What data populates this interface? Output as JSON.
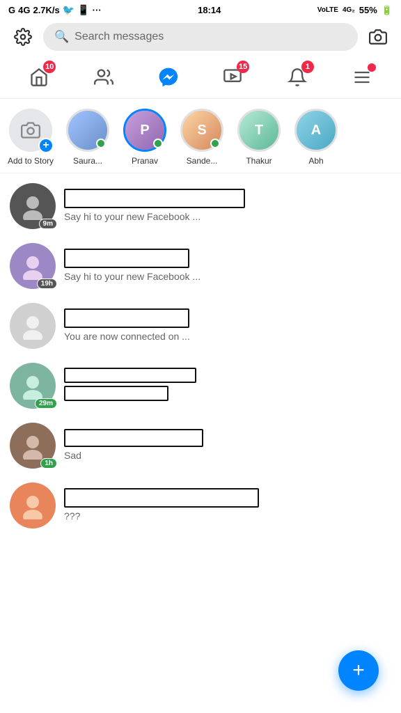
{
  "statusBar": {
    "left": "G 4G 2.7K/s",
    "time": "18:14",
    "right": "55%"
  },
  "topBar": {
    "searchPlaceholder": "Search messages"
  },
  "navBar": {
    "items": [
      {
        "id": "home",
        "icon": "🏠",
        "badge": "10"
      },
      {
        "id": "people",
        "icon": "👥",
        "badge": ""
      },
      {
        "id": "messenger",
        "icon": "💬",
        "badge": "",
        "active": true
      },
      {
        "id": "watch",
        "icon": "▶",
        "badge": "15"
      },
      {
        "id": "bell",
        "icon": "🔔",
        "badge": "1"
      },
      {
        "id": "menu",
        "icon": "☰",
        "badge": "dot"
      }
    ]
  },
  "stories": [
    {
      "id": "add",
      "label": "Add to Story",
      "type": "add"
    },
    {
      "id": "saura",
      "label": "Saura...",
      "online": true
    },
    {
      "id": "pranav",
      "label": "Pranav",
      "online": true,
      "ring": true
    },
    {
      "id": "sande",
      "label": "Sande...",
      "online": true
    },
    {
      "id": "thakur",
      "label": "Thakur",
      "online": false
    },
    {
      "id": "abh",
      "label": "Abh",
      "online": false
    }
  ],
  "chats": [
    {
      "id": "chat1",
      "timeBadge": "9m",
      "preview": "Say hi to your new Facebook ...",
      "avatarClass": "dark"
    },
    {
      "id": "chat2",
      "timeBadge": "19h",
      "preview": "Say hi to your new Facebook ...",
      "avatarClass": "purple"
    },
    {
      "id": "chat3",
      "timeBadge": "",
      "preview": "You are now connected on ...",
      "avatarClass": "grey-light"
    },
    {
      "id": "chat4",
      "timeBadge": "29m",
      "preview": "",
      "doubleRow": true,
      "avatarClass": "green-teal"
    },
    {
      "id": "chat5",
      "timeBadge": "1h",
      "preview": "Sad",
      "avatarClass": "brown"
    },
    {
      "id": "chat6",
      "timeBadge": "",
      "preview": "???",
      "avatarClass": "orange"
    }
  ],
  "fab": {
    "icon": "+"
  }
}
